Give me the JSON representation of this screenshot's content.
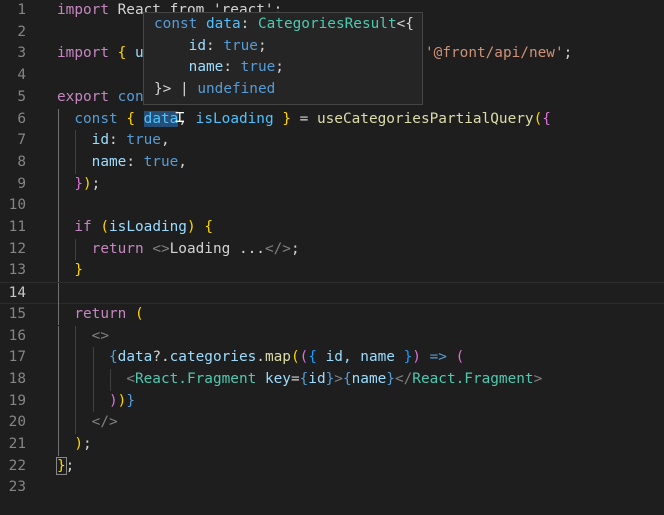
{
  "editor": {
    "lines": [
      {
        "n": "1",
        "guides": [],
        "tokens": [
          {
            "t": "import",
            "c": "#c586c0"
          },
          {
            "t": " React from 'react';",
            "c": "#d4d4d4"
          }
        ]
      },
      {
        "n": "2",
        "guides": [],
        "tokens": []
      },
      {
        "n": "3",
        "guides": [],
        "tokens": [
          {
            "t": "import",
            "c": "#c586c0"
          },
          {
            "t": " ",
            "c": "#d4d4d4"
          },
          {
            "t": "{",
            "c": "#ffd700"
          },
          {
            "t": " u",
            "c": "#9cdcfe"
          }
        ]
      },
      {
        "n": "4",
        "guides": [],
        "tokens": []
      },
      {
        "n": "5",
        "guides": [],
        "tokens": [
          {
            "t": "export",
            "c": "#c586c0"
          },
          {
            "t": " con",
            "c": "#569cd6"
          }
        ]
      },
      {
        "n": "6",
        "guides": [
          0
        ],
        "tokens": [
          {
            "t": "  ",
            "c": "#d4d4d4"
          },
          {
            "t": "const",
            "c": "#569cd6"
          },
          {
            "t": " ",
            "c": "#d4d4d4"
          },
          {
            "t": "{",
            "c": "#ffd700"
          },
          {
            "t": " ",
            "c": "#d4d4d4"
          },
          {
            "t": "data",
            "c": "#4fc1ff",
            "bg": "#264f78"
          },
          {
            "t": ",",
            "c": "#d4d4d4"
          },
          {
            "t": " isLoading ",
            "c": "#4fc1ff"
          },
          {
            "t": "}",
            "c": "#ffd700"
          },
          {
            "t": " = ",
            "c": "#d4d4d4"
          },
          {
            "t": "useCategoriesPartialQuery",
            "c": "#dcdcaa"
          },
          {
            "t": "(",
            "c": "#ffd700"
          },
          {
            "t": "{",
            "c": "#da70d6"
          }
        ]
      },
      {
        "n": "7",
        "guides": [
          0,
          1
        ],
        "tokens": [
          {
            "t": "    ",
            "c": "#d4d4d4"
          },
          {
            "t": "id",
            "c": "#9cdcfe"
          },
          {
            "t": ": ",
            "c": "#d4d4d4"
          },
          {
            "t": "true",
            "c": "#569cd6"
          },
          {
            "t": ",",
            "c": "#d4d4d4"
          }
        ]
      },
      {
        "n": "8",
        "guides": [
          0,
          1
        ],
        "tokens": [
          {
            "t": "    ",
            "c": "#d4d4d4"
          },
          {
            "t": "name",
            "c": "#9cdcfe"
          },
          {
            "t": ": ",
            "c": "#d4d4d4"
          },
          {
            "t": "true",
            "c": "#569cd6"
          },
          {
            "t": ",",
            "c": "#d4d4d4"
          }
        ]
      },
      {
        "n": "9",
        "guides": [
          0
        ],
        "tokens": [
          {
            "t": "  ",
            "c": "#d4d4d4"
          },
          {
            "t": "}",
            "c": "#da70d6"
          },
          {
            "t": ")",
            "c": "#ffd700"
          },
          {
            "t": ";",
            "c": "#d4d4d4"
          }
        ]
      },
      {
        "n": "10",
        "guides": [
          0
        ],
        "tokens": []
      },
      {
        "n": "11",
        "guides": [
          0
        ],
        "tokens": [
          {
            "t": "  ",
            "c": "#d4d4d4"
          },
          {
            "t": "if",
            "c": "#c586c0"
          },
          {
            "t": " ",
            "c": "#d4d4d4"
          },
          {
            "t": "(",
            "c": "#ffd700"
          },
          {
            "t": "isLoading",
            "c": "#9cdcfe"
          },
          {
            "t": ")",
            "c": "#ffd700"
          },
          {
            "t": " ",
            "c": "#d4d4d4"
          },
          {
            "t": "{",
            "c": "#ffd700"
          }
        ]
      },
      {
        "n": "12",
        "guides": [
          0,
          1
        ],
        "tokens": [
          {
            "t": "    ",
            "c": "#d4d4d4"
          },
          {
            "t": "return",
            "c": "#c586c0"
          },
          {
            "t": " ",
            "c": "#d4d4d4"
          },
          {
            "t": "<>",
            "c": "#808080"
          },
          {
            "t": "Loading ...",
            "c": "#d4d4d4"
          },
          {
            "t": "</>",
            "c": "#808080"
          },
          {
            "t": ";",
            "c": "#d4d4d4"
          }
        ]
      },
      {
        "n": "13",
        "guides": [
          0
        ],
        "tokens": [
          {
            "t": "  ",
            "c": "#d4d4d4"
          },
          {
            "t": "}",
            "c": "#ffd700"
          }
        ]
      },
      {
        "n": "14",
        "guides": [
          0
        ],
        "current": true,
        "tokens": []
      },
      {
        "n": "15",
        "guides": [
          0
        ],
        "tokens": [
          {
            "t": "  ",
            "c": "#d4d4d4"
          },
          {
            "t": "return",
            "c": "#c586c0"
          },
          {
            "t": " ",
            "c": "#d4d4d4"
          },
          {
            "t": "(",
            "c": "#ffd700"
          }
        ]
      },
      {
        "n": "16",
        "guides": [
          0,
          1
        ],
        "tokens": [
          {
            "t": "    ",
            "c": "#d4d4d4"
          },
          {
            "t": "<>",
            "c": "#808080"
          }
        ]
      },
      {
        "n": "17",
        "guides": [
          0,
          1,
          2
        ],
        "tokens": [
          {
            "t": "      ",
            "c": "#d4d4d4"
          },
          {
            "t": "{",
            "c": "#569cd6"
          },
          {
            "t": "data",
            "c": "#9cdcfe"
          },
          {
            "t": "?.",
            "c": "#d4d4d4"
          },
          {
            "t": "categories",
            "c": "#9cdcfe"
          },
          {
            "t": ".",
            "c": "#d4d4d4"
          },
          {
            "t": "map",
            "c": "#dcdcaa"
          },
          {
            "t": "(",
            "c": "#ffd700"
          },
          {
            "t": "(",
            "c": "#da70d6"
          },
          {
            "t": "{",
            "c": "#179fff"
          },
          {
            "t": " id, name ",
            "c": "#9cdcfe"
          },
          {
            "t": "}",
            "c": "#179fff"
          },
          {
            "t": ")",
            "c": "#da70d6"
          },
          {
            "t": " ",
            "c": "#d4d4d4"
          },
          {
            "t": "=>",
            "c": "#569cd6"
          },
          {
            "t": " ",
            "c": "#d4d4d4"
          },
          {
            "t": "(",
            "c": "#da70d6"
          }
        ]
      },
      {
        "n": "18",
        "guides": [
          0,
          1,
          2,
          3
        ],
        "tokens": [
          {
            "t": "        ",
            "c": "#d4d4d4"
          },
          {
            "t": "<",
            "c": "#808080"
          },
          {
            "t": "React.Fragment",
            "c": "#4ec9b0"
          },
          {
            "t": " ",
            "c": "#d4d4d4"
          },
          {
            "t": "key",
            "c": "#9cdcfe"
          },
          {
            "t": "=",
            "c": "#d4d4d4"
          },
          {
            "t": "{",
            "c": "#569cd6"
          },
          {
            "t": "id",
            "c": "#9cdcfe"
          },
          {
            "t": "}",
            "c": "#569cd6"
          },
          {
            "t": ">",
            "c": "#808080"
          },
          {
            "t": "{",
            "c": "#569cd6"
          },
          {
            "t": "name",
            "c": "#9cdcfe"
          },
          {
            "t": "}",
            "c": "#569cd6"
          },
          {
            "t": "</",
            "c": "#808080"
          },
          {
            "t": "React.Fragment",
            "c": "#4ec9b0"
          },
          {
            "t": ">",
            "c": "#808080"
          }
        ]
      },
      {
        "n": "19",
        "guides": [
          0,
          1,
          2
        ],
        "tokens": [
          {
            "t": "      ",
            "c": "#d4d4d4"
          },
          {
            "t": ")",
            "c": "#da70d6"
          },
          {
            "t": ")",
            "c": "#ffd700"
          },
          {
            "t": "}",
            "c": "#569cd6"
          }
        ]
      },
      {
        "n": "20",
        "guides": [
          0,
          1
        ],
        "tokens": [
          {
            "t": "    ",
            "c": "#d4d4d4"
          },
          {
            "t": "</>",
            "c": "#808080"
          }
        ]
      },
      {
        "n": "21",
        "guides": [
          0
        ],
        "tokens": [
          {
            "t": "  ",
            "c": "#d4d4d4"
          },
          {
            "t": ")",
            "c": "#ffd700"
          },
          {
            "t": ";",
            "c": "#d4d4d4"
          }
        ]
      },
      {
        "n": "22",
        "guides": [],
        "tokens": [
          {
            "t": "}",
            "c": "#ffd700",
            "box": true
          },
          {
            "t": ";",
            "c": "#d4d4d4"
          }
        ]
      },
      {
        "n": "23",
        "guides": [],
        "tokens": []
      }
    ],
    "tail_line3": [
      {
        "t": "'@front/api/new'",
        "c": "#ce9178"
      },
      {
        "t": ";",
        "c": "#d4d4d4"
      }
    ]
  },
  "hover": {
    "lines": [
      [
        {
          "t": "const",
          "c": "#569cd6"
        },
        {
          "t": " ",
          "c": "#d4d4d4"
        },
        {
          "t": "data",
          "c": "#4fc1ff"
        },
        {
          "t": ": ",
          "c": "#d4d4d4"
        },
        {
          "t": "CategoriesResult",
          "c": "#4ec9b0"
        },
        {
          "t": "<{",
          "c": "#d4d4d4"
        }
      ],
      [
        {
          "t": "    ",
          "c": "#d4d4d4"
        },
        {
          "t": "id",
          "c": "#9cdcfe"
        },
        {
          "t": ": ",
          "c": "#d4d4d4"
        },
        {
          "t": "true",
          "c": "#569cd6"
        },
        {
          "t": ";",
          "c": "#d4d4d4"
        }
      ],
      [
        {
          "t": "    ",
          "c": "#d4d4d4"
        },
        {
          "t": "name",
          "c": "#9cdcfe"
        },
        {
          "t": ": ",
          "c": "#d4d4d4"
        },
        {
          "t": "true",
          "c": "#569cd6"
        },
        {
          "t": ";",
          "c": "#d4d4d4"
        }
      ],
      [
        {
          "t": "}> | ",
          "c": "#d4d4d4"
        },
        {
          "t": "undefined",
          "c": "#569cd6"
        }
      ]
    ]
  }
}
